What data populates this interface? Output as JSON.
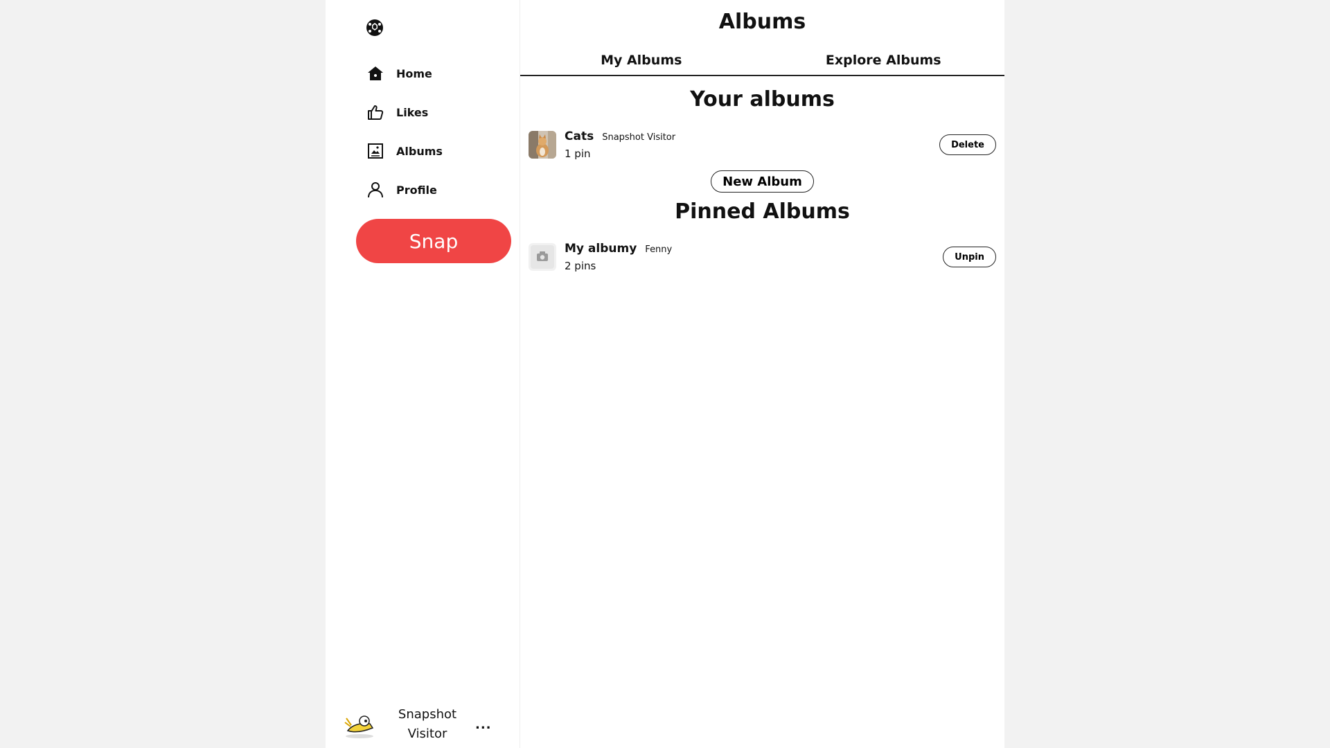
{
  "sidebar": {
    "logo_icon": "turtle-shell-icon",
    "items": [
      {
        "label": "Home",
        "icon": "home-icon"
      },
      {
        "label": "Likes",
        "icon": "thumbs-up-icon"
      },
      {
        "label": "Albums",
        "icon": "album-icon"
      },
      {
        "label": "Profile",
        "icon": "person-icon"
      }
    ],
    "snap_label": "Snap",
    "user": {
      "name": "Snapshot Visitor",
      "more": "..."
    }
  },
  "main": {
    "title": "Albums",
    "tabs": [
      {
        "label": "My Albums"
      },
      {
        "label": "Explore Albums"
      }
    ],
    "your_albums_title": "Your albums",
    "your_albums": [
      {
        "name": "Cats",
        "owner": "Snapshot Visitor",
        "count": "1 pin",
        "action": "Delete"
      }
    ],
    "new_album_label": "New Album",
    "pinned_title": "Pinned Albums",
    "pinned_albums": [
      {
        "name": "My albumy",
        "owner": "Fenny",
        "count": "2 pins",
        "action": "Unpin"
      }
    ]
  },
  "colors": {
    "accent": "#f04545",
    "page_bg": "#f2f2f2"
  }
}
